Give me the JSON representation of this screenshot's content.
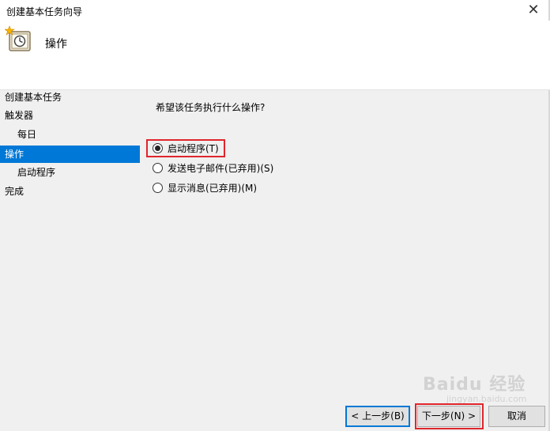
{
  "window": {
    "title": "创建基本任务向导",
    "close_glyph": "✕"
  },
  "header": {
    "title": "操作",
    "icon": "scheduled-task-clock-icon"
  },
  "nav": {
    "items": [
      {
        "label": "创建基本任务",
        "level": 0,
        "active": false
      },
      {
        "label": "触发器",
        "level": 0,
        "active": false
      },
      {
        "label": "每日",
        "level": 1,
        "active": false
      },
      {
        "label": "操作",
        "level": 0,
        "active": true
      },
      {
        "label": "启动程序",
        "level": 1,
        "active": false
      },
      {
        "label": "完成",
        "level": 0,
        "active": false
      }
    ]
  },
  "main": {
    "question": "希望该任务执行什么操作?",
    "options": [
      {
        "label": "启动程序(T)",
        "checked": true
      },
      {
        "label": "发送电子邮件(已弃用)(S)",
        "checked": false
      },
      {
        "label": "显示消息(已弃用)(M)",
        "checked": false
      }
    ]
  },
  "buttons": {
    "back": "< 上一步(B)",
    "next": "下一步(N) >",
    "cancel": "取消"
  },
  "watermark": {
    "text": "Baidu 经验",
    "sub": "jingyan.baidu.com"
  },
  "colors": {
    "accent": "#0078d7",
    "highlight_box": "#e0262c"
  }
}
